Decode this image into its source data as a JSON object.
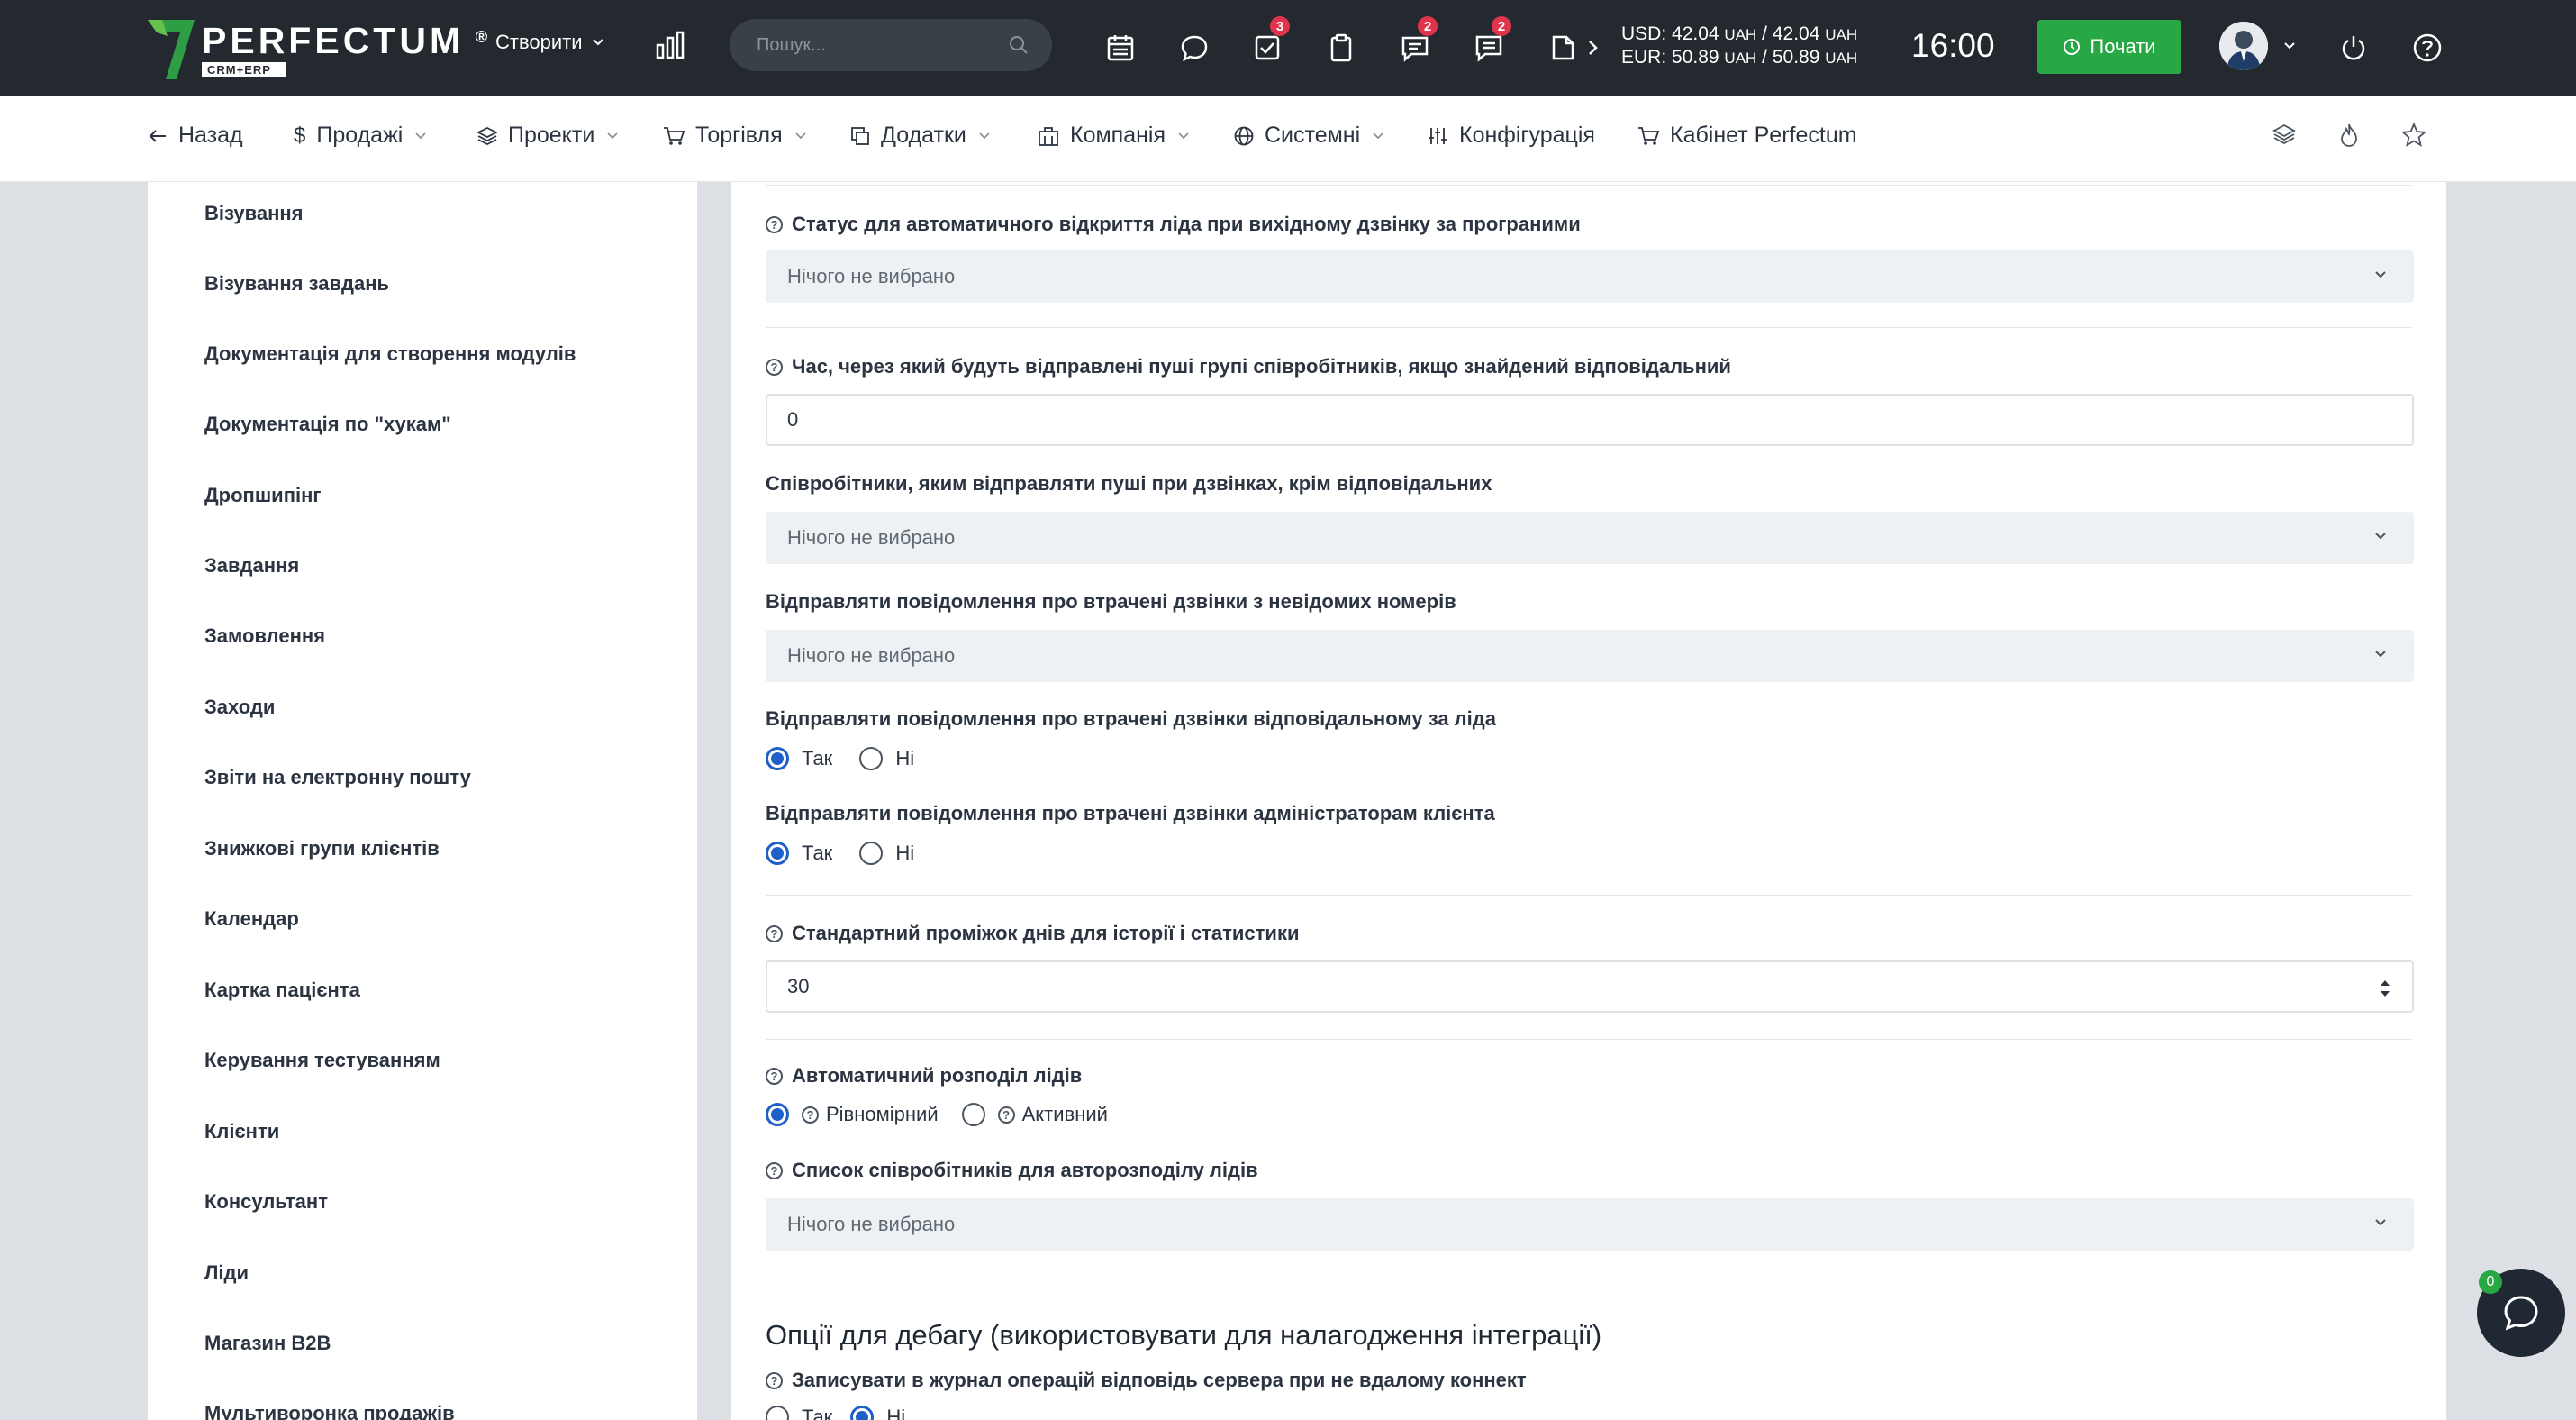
{
  "topbar": {
    "logo": {
      "name": "PERFECTUM",
      "sub": "CRM+ERP",
      "reg": "®"
    },
    "create_label": "Створити",
    "search_placeholder": "Пошук...",
    "badges": {
      "tasks": "3",
      "messages": "2",
      "notes": "2"
    },
    "rates": {
      "usd_prefix": "USD: ",
      "usd_value": "42.04",
      "usd_value2": "42.04",
      "eur_prefix": "EUR: ",
      "eur_value": "50.89",
      "eur_value2": "50.89",
      "currency": "UAH",
      "sep": " / "
    },
    "clock": "16:00",
    "start_label": "Почати",
    "icons": [
      "chevron-down-icon",
      "bar-chart-icon",
      "search-icon",
      "calendar-icon",
      "chat-bubble-icon",
      "check-square-icon",
      "clipboard-icon",
      "message-icon",
      "comments-icon",
      "file-icon",
      "chevron-right-icon",
      "clock-icon",
      "power-icon",
      "help-icon"
    ]
  },
  "navbar": {
    "back": "Назад",
    "items": [
      {
        "label": "Продажі",
        "icon": "dollar-icon"
      },
      {
        "label": "Проекти",
        "icon": "layers-icon"
      },
      {
        "label": "Торгівля",
        "icon": "cart-icon"
      },
      {
        "label": "Додатки",
        "icon": "copy-icon"
      },
      {
        "label": "Компанія",
        "icon": "building-icon"
      },
      {
        "label": "Системні",
        "icon": "globe-icon"
      },
      {
        "label": "Конфігурація",
        "icon": "sliders-icon"
      },
      {
        "label": "Кабінет Perfectum",
        "icon": "cart-icon"
      }
    ]
  },
  "sidebar": {
    "items": [
      "Візування",
      "Візування завдань",
      "Документація для створення модулів",
      "Документація по \"хукам\"",
      "Дропшипінг",
      "Завдання",
      "Замовлення",
      "Заходи",
      "Звіти на електронну пошту",
      "Знижкові групи клієнтів",
      "Календар",
      "Картка пацієнта",
      "Керування тестуванням",
      "Клієнти",
      "Консультант",
      "Ліди",
      "Магазин B2B",
      "Мультиворонка продажів"
    ]
  },
  "form": {
    "placeholder": "Нічого не вибрано",
    "yes": "Так",
    "no": "Ні",
    "f1_label": "Статус для автоматичного відкриття ліда при вихідному дзвінку за програними",
    "f2_label": "Час, через який будуть відправлені пуші групі співробітників, якщо знайдений відповідальний",
    "f2_value": "0",
    "f3_label": "Співробітники, яким відправляти пуші при дзвінках, крім відповідальних",
    "f4_label": "Відправляти повідомлення про втрачені дзвінки з невідомих номерів",
    "f5_label": "Відправляти повідомлення про втрачені дзвінки відповідальному за ліда",
    "f6_label": "Відправляти повідомлення про втрачені дзвінки адміністраторам клієнта",
    "f7_label": "Стандартний проміжок днів для історії і статистики",
    "f7_value": "30",
    "f8_label": "Автоматичний розподіл лідів",
    "f8_opt1": "Рівномірний",
    "f8_opt2": "Активний",
    "f9_label": "Список співробітників для авторозподілу лідів",
    "debug_title": "Опції для дебагу (використовувати для налагодження інтеграції)",
    "f10_label": "Записувати в журнал операцій відповідь сервера при не вдалому коннект"
  },
  "chat": {
    "count": "0"
  },
  "colors": {
    "topbar": "#24292f",
    "accent": "#1f5fc9",
    "green": "#28a745",
    "badge": "#e0344b"
  }
}
